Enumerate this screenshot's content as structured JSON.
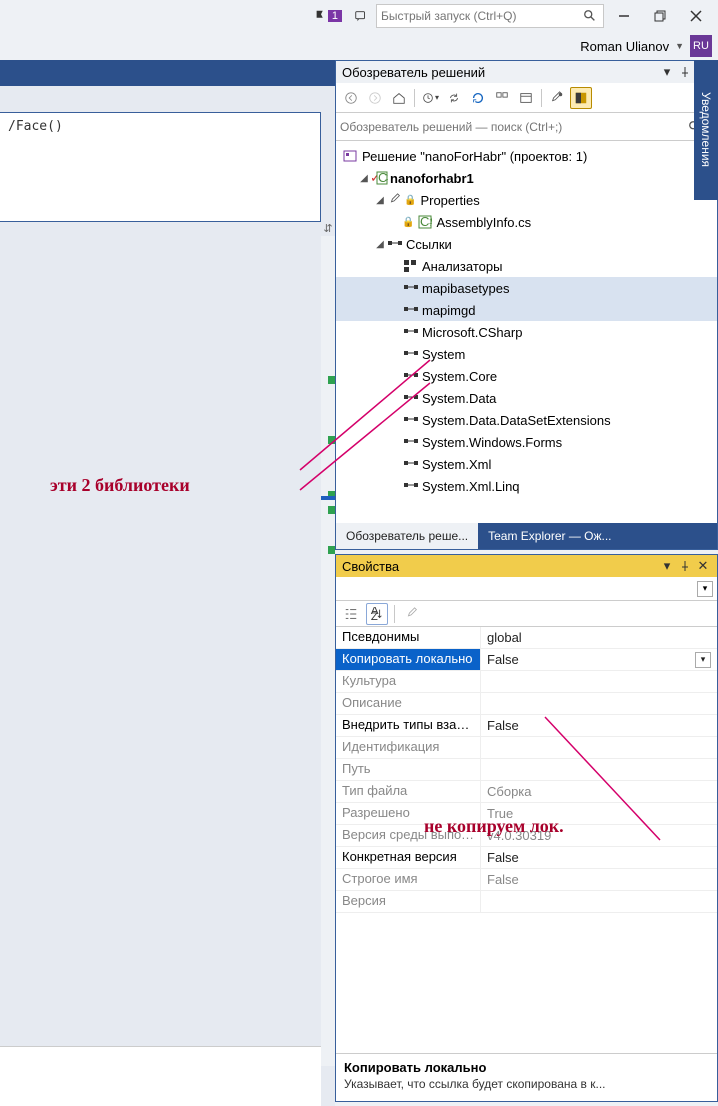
{
  "topbar": {
    "flag_count": "1",
    "search_placeholder": "Быстрый запуск (Ctrl+Q)"
  },
  "user": {
    "name": "Roman Ulianov",
    "initials": "RU"
  },
  "editor": {
    "fragment": "/Face()"
  },
  "side_tab": "Уведомления",
  "solution_explorer": {
    "title": "Обозреватель решений",
    "search_placeholder": "Обозреватель решений — поиск (Ctrl+;)",
    "solution_label": "Решение \"nanoForHabr\" (проектов: 1)",
    "project": "nanoforhabr1",
    "properties": "Properties",
    "assemblyinfo": "AssemblyInfo.cs",
    "references": "Ссылки",
    "analyzers": "Анализаторы",
    "refs": [
      "mapibasetypes",
      "mapimgd",
      "Microsoft.CSharp",
      "System",
      "System.Core",
      "System.Data",
      "System.Data.DataSetExtensions",
      "System.Windows.Forms",
      "System.Xml",
      "System.Xml.Linq"
    ],
    "tabs": {
      "a": "Обозреватель реше...",
      "b": "Team Explorer — Ож..."
    }
  },
  "properties_panel": {
    "title": "Свойства",
    "rows": [
      {
        "name": "Псевдонимы",
        "value": "global"
      },
      {
        "name": "Копировать локально",
        "value": "False",
        "selected": true,
        "dropdown": true
      },
      {
        "name": "Культура",
        "value": "",
        "dim": true
      },
      {
        "name": "Описание",
        "value": "",
        "dim": true
      },
      {
        "name": "Внедрить типы взаимодействия",
        "value": "False"
      },
      {
        "name": "Идентификация",
        "value": "",
        "dim": true
      },
      {
        "name": "Путь",
        "value": "",
        "dim": true
      },
      {
        "name": "Тип файла",
        "value": "Сборка",
        "dim": true
      },
      {
        "name": "Разрешено",
        "value": "True",
        "dim": true
      },
      {
        "name": "Версия среды выполнения",
        "value": "v4.0.30319",
        "dim": true
      },
      {
        "name": "Конкретная версия",
        "value": "False"
      },
      {
        "name": "Строгое имя",
        "value": "False",
        "dim": true
      },
      {
        "name": "Версия",
        "value": "",
        "dim": true
      }
    ],
    "desc_title": "Копировать локально",
    "desc_text": "Указывает, что ссылка будет скопирована в к..."
  },
  "annotations": {
    "libs": "эти 2 библиотеки",
    "nocopy": "не копируем лок."
  }
}
